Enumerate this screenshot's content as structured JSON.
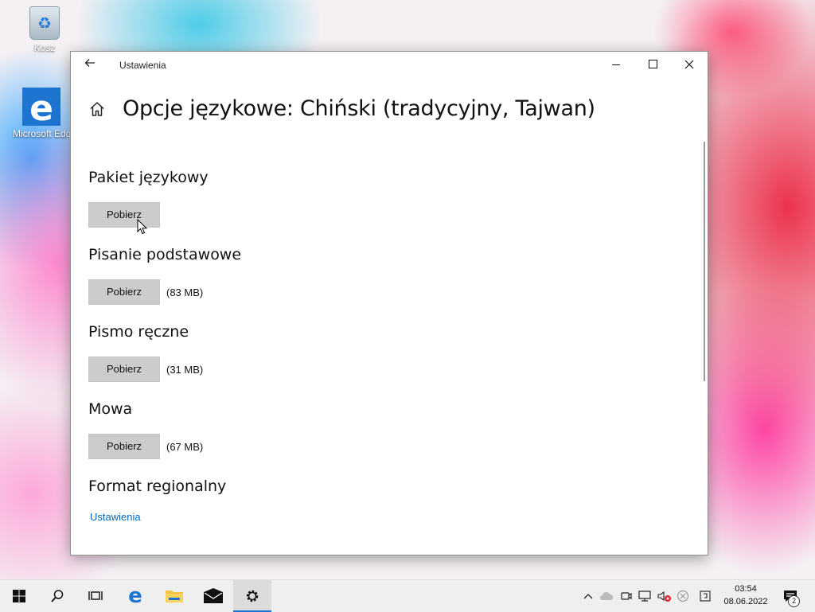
{
  "desktop": {
    "icons": [
      {
        "label": "Kosz",
        "icon": "recycle-bin-icon"
      },
      {
        "label": "Microsoft Edge",
        "icon": "edge-icon"
      }
    ]
  },
  "window": {
    "title": "Ustawienia",
    "page_title": "Opcje językowe: Chiński (tradycyjny, Tajwan)",
    "sections": [
      {
        "title": "Pakiet językowy",
        "button": "Pobierz",
        "size": ""
      },
      {
        "title": "Pisanie podstawowe",
        "button": "Pobierz",
        "size": "(83 MB)"
      },
      {
        "title": "Pismo ręczne",
        "button": "Pobierz",
        "size": "(31 MB)"
      },
      {
        "title": "Mowa",
        "button": "Pobierz",
        "size": "(67 MB)"
      }
    ],
    "regional": {
      "title": "Format regionalny",
      "link": "Ustawienia"
    }
  },
  "taskbar": {
    "clock_time": "03:54",
    "clock_date": "08.06.2022",
    "notification_count": "2"
  },
  "colors": {
    "accent": "#0067b8",
    "button_bg": "#cccccc",
    "taskbar_bg": "#f0efef"
  }
}
